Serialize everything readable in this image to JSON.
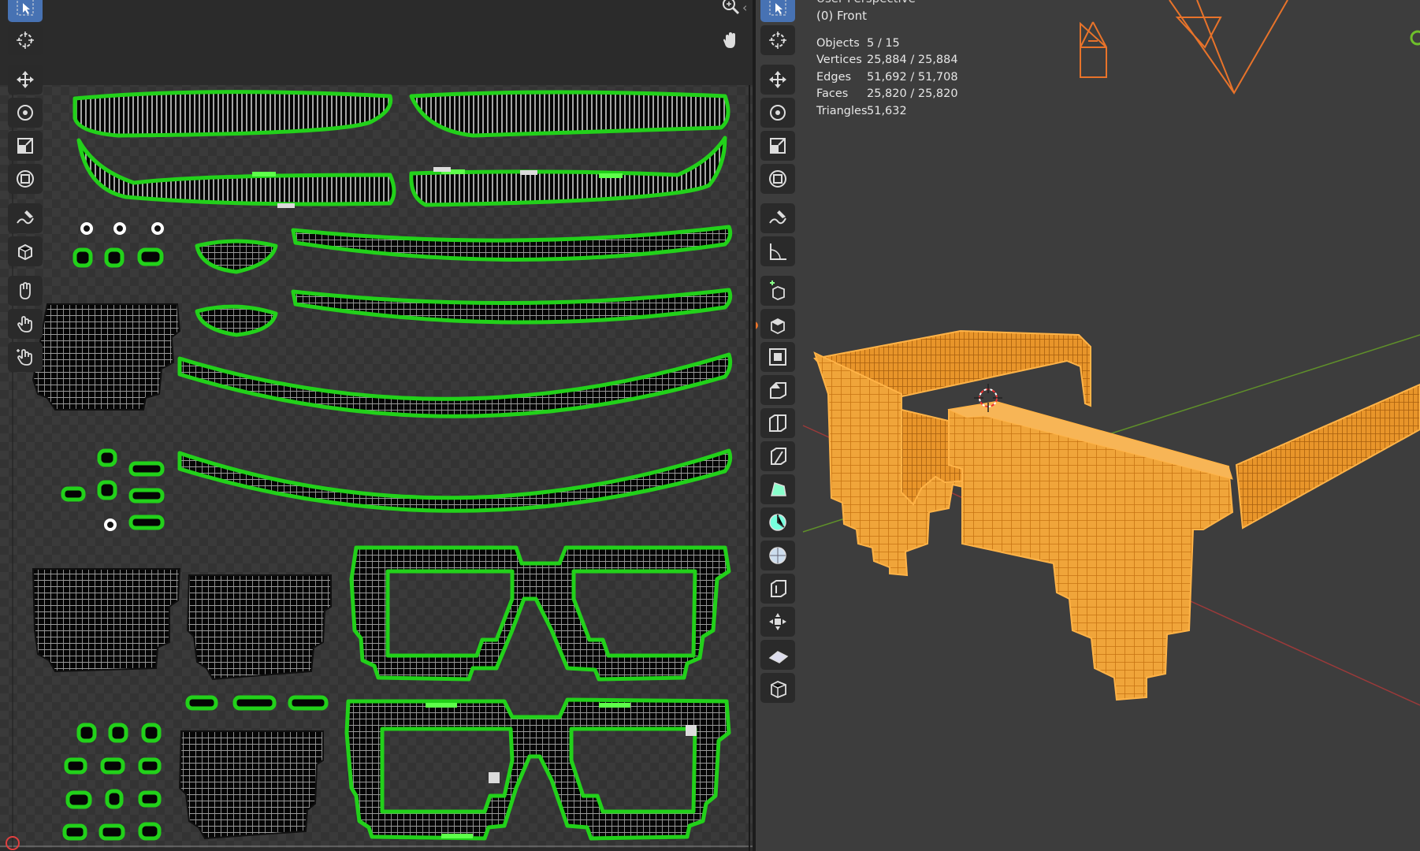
{
  "viewport": {
    "view_name": "User Perspective",
    "view_sub": "(0) Front",
    "stats": [
      {
        "label": "Objects",
        "value": "5 / 15"
      },
      {
        "label": "Vertices",
        "value": "25,884 / 25,884"
      },
      {
        "label": "Edges",
        "value": "51,692 / 51,708"
      },
      {
        "label": "Faces",
        "value": "25,820 / 25,820"
      },
      {
        "label": "Triangles",
        "value": "51,632"
      }
    ]
  },
  "colors": {
    "uv_island_outline": "#22d11a",
    "uv_island_fill": "#050505",
    "selection_orange": "#f59a23",
    "active_tool": "#4772b3",
    "x_axis": "#9b3a3a",
    "y_axis": "#5f8f2a"
  },
  "uv_tools": [
    "select-box-icon",
    "cursor-icon",
    "move-icon",
    "rotate-icon",
    "scale-icon",
    "transform-icon",
    "annotate-icon",
    "grab-icon",
    "relax-icon",
    "pinch-icon",
    "hand-icon"
  ],
  "viewport_tools": [
    "select-box-icon",
    "cursor-icon",
    "move-icon",
    "rotate-icon",
    "scale-icon",
    "transform-icon",
    "annotate-icon",
    "measure-icon",
    "add-cube-icon",
    "extrude-icon",
    "inset-icon",
    "bevel-icon",
    "loop-cut-icon",
    "knife-icon",
    "poly-build-icon",
    "spin-icon",
    "smooth-icon",
    "edge-slide-icon",
    "shrink-icon",
    "shear-icon",
    "rip-icon"
  ]
}
